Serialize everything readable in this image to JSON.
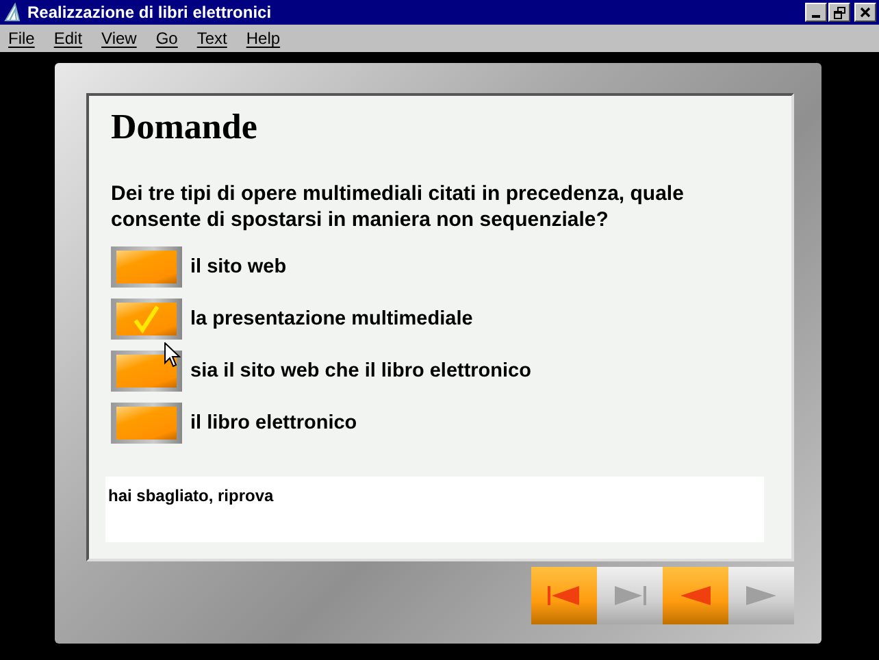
{
  "window": {
    "title": "Realizzazione di libri elettronici"
  },
  "menu": [
    "File",
    "Edit",
    "View",
    "Go",
    "Text",
    "Help"
  ],
  "heading": "Domande",
  "question": "Dei tre tipi di opere multimediali citati in precedenza, quale consente di spostarsi in maniera non sequenziale?",
  "options": [
    {
      "label": "il sito web",
      "selected": false
    },
    {
      "label": "la presentazione multimediale",
      "selected": true
    },
    {
      "label": "sia il sito web che il libro elettronico",
      "selected": false
    },
    {
      "label": "il libro elettronico",
      "selected": false
    }
  ],
  "feedback": "hai sbagliato, riprova",
  "nav": [
    {
      "kind": "first",
      "disabled": false
    },
    {
      "kind": "last",
      "disabled": true
    },
    {
      "kind": "prev",
      "disabled": false
    },
    {
      "kind": "next",
      "disabled": true
    }
  ]
}
